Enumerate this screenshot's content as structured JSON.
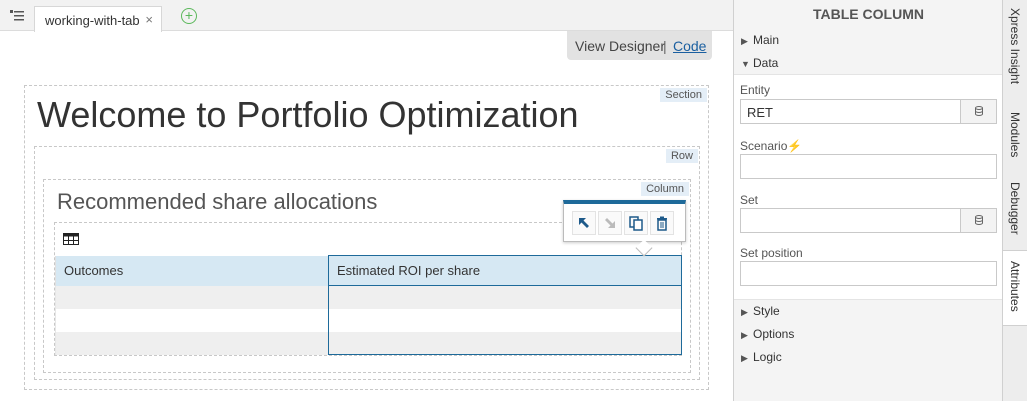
{
  "tabs": {
    "doc_tab_label": "working-with-tab",
    "close_glyph": "×",
    "add_glyph": "+"
  },
  "viewbar": {
    "view_designer": "View Designer",
    "separator": "|",
    "code": "Code"
  },
  "designer": {
    "section_tag": "Section",
    "row_tag": "Row",
    "column_tag": "Column",
    "page_title": "Welcome to Portfolio Optimization",
    "column_heading": "Recommended share allocations",
    "table": {
      "headers": [
        "Outcomes",
        "Estimated ROI per share"
      ]
    }
  },
  "panel": {
    "title": "TABLE COLUMN",
    "sections": {
      "main": "Main",
      "data": "Data",
      "style": "Style",
      "options": "Options",
      "logic": "Logic"
    },
    "fields": {
      "entity_label": "Entity",
      "entity_value": "RET",
      "scenario_label": "Scenario",
      "set_label": "Set",
      "set_position_label": "Set position"
    }
  },
  "side_tabs": [
    "Xpress Insight",
    "Modules",
    "Debugger",
    "Attributes"
  ],
  "colors": {
    "accent": "#1e6a9a",
    "header_fill": "#d6e8f3",
    "scenario_bolt": "#f0a500",
    "add_tab_green": "#5cb85c"
  }
}
